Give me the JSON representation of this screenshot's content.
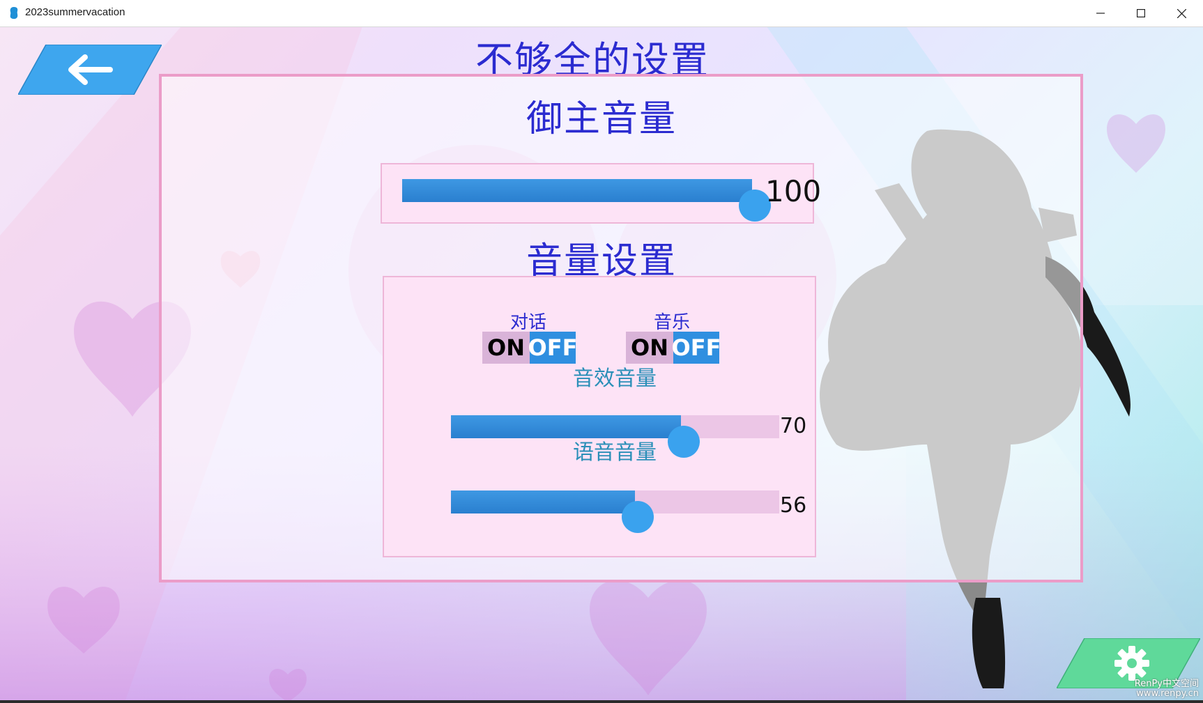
{
  "window": {
    "title": "2023summervacation",
    "minimize_icon": "minimize-icon",
    "maximize_icon": "maximize-icon",
    "close_icon": "close-icon"
  },
  "header": {
    "title": "不够全的设置",
    "back_icon": "arrow-left-icon"
  },
  "master_volume": {
    "title": "御主音量",
    "value": 100,
    "value_text": "100",
    "max": 100
  },
  "volume_settings": {
    "title": "音量设置",
    "toggles": [
      {
        "label": "对话",
        "on_text": "ON",
        "off_text": "OFF",
        "selected": "OFF"
      },
      {
        "label": "音乐",
        "on_text": "ON",
        "off_text": "OFF",
        "selected": "OFF"
      }
    ],
    "sliders": [
      {
        "label": "音效音量",
        "value": 70,
        "value_text": "70",
        "max": 100
      },
      {
        "label": "语音音量",
        "value": 56,
        "value_text": "56",
        "max": 100
      }
    ]
  },
  "footer": {
    "settings_icon": "gear-icon",
    "watermark_line1": "RenPy中文空间",
    "watermark_line2": "www.renpy.cn"
  },
  "colors": {
    "title_blue": "#2b2bd0",
    "accent_blue": "#3aa2ee",
    "panel_border_pink": "#eb9cc8",
    "settings_green": "#5fd99a"
  }
}
